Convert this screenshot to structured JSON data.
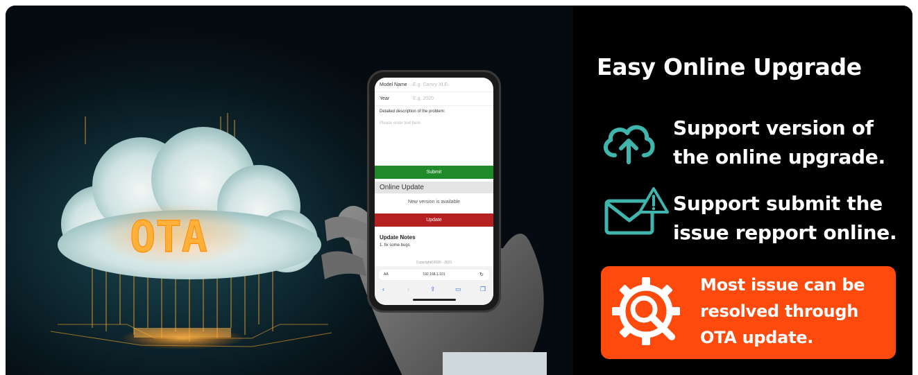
{
  "banner": {
    "title": "Easy Online Upgrade",
    "cloud_label": "OTA",
    "features": [
      {
        "icon": "cloud-upload-icon",
        "text_line1": "Support version of",
        "text_line2": "the online upgrade."
      },
      {
        "icon": "mail-warning-icon",
        "text_line1": "Support submit the",
        "text_line2": "issue repport online."
      }
    ],
    "callout": {
      "icon": "gear-search-icon",
      "line1": "Most issue can be",
      "line2": "resolved through",
      "line3": "OTA update."
    },
    "colors": {
      "accent_teal": "#3fb5ad",
      "callout_orange": "#ff4a0d",
      "submit_green": "#1f8a2a",
      "update_red": "#b52020"
    }
  },
  "phone": {
    "form": {
      "model_label": "Model Name",
      "model_placeholder": "E.g. Camry XLE",
      "year_label": "Year",
      "year_placeholder": "E.g. 2020",
      "description_label": "Detailed description of the problem:",
      "description_placeholder": "Please enter text here",
      "submit_label": "Submit"
    },
    "online_update": {
      "header": "Online Update",
      "status": "New version is available",
      "update_label": "Update",
      "notes_title": "Update Notes",
      "notes_item": "1. fix some bugs",
      "copyright": "Copyright©2020 - 2021"
    },
    "browser": {
      "aa_label": "AA",
      "url": "192.168.1.101"
    }
  }
}
